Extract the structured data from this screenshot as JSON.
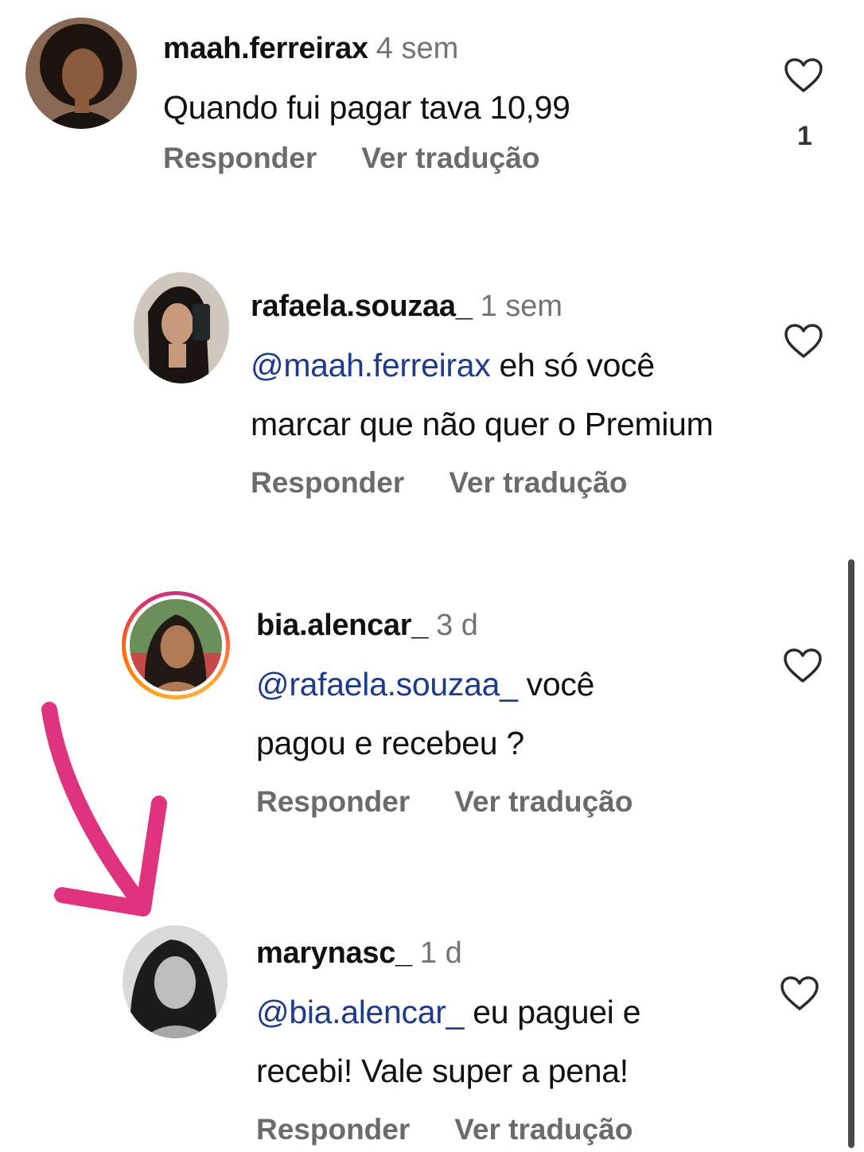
{
  "comments": [
    {
      "username": "maah.ferreirax",
      "time": "4 sem",
      "mention": "",
      "text_line1": "Quando fui pagar tava 10,99",
      "text_line2": "",
      "likes": "1",
      "reply_label": "Responder",
      "translate_label": "Ver tradução"
    },
    {
      "username": "rafaela.souzaa_",
      "time": "1 sem",
      "mention": "@maah.ferreirax",
      "text_line1": " eh só você",
      "text_line2": "marcar que não quer o Premium",
      "likes": "",
      "reply_label": "Responder",
      "translate_label": "Ver tradução"
    },
    {
      "username": "bia.alencar_",
      "time": "3 d",
      "mention": "@rafaela.souzaa_",
      "text_line1": " você",
      "text_line2": "pagou e recebeu ?",
      "likes": "",
      "reply_label": "Responder",
      "translate_label": "Ver tradução"
    },
    {
      "username": "marynasc_",
      "time": "1 d",
      "mention": "@bia.alencar_",
      "text_line1": " eu paguei e",
      "text_line2": "recebi! Vale super a pena!",
      "likes": "",
      "reply_label": "Responder",
      "translate_label": "Ver tradução"
    }
  ],
  "colors": {
    "mention": "#1e3a8a",
    "annotation_arrow": "#e0337f",
    "muted_text": "#737373"
  },
  "icons": {
    "like": "heart-outline-icon",
    "annotation": "pink-arrow-annotation"
  }
}
